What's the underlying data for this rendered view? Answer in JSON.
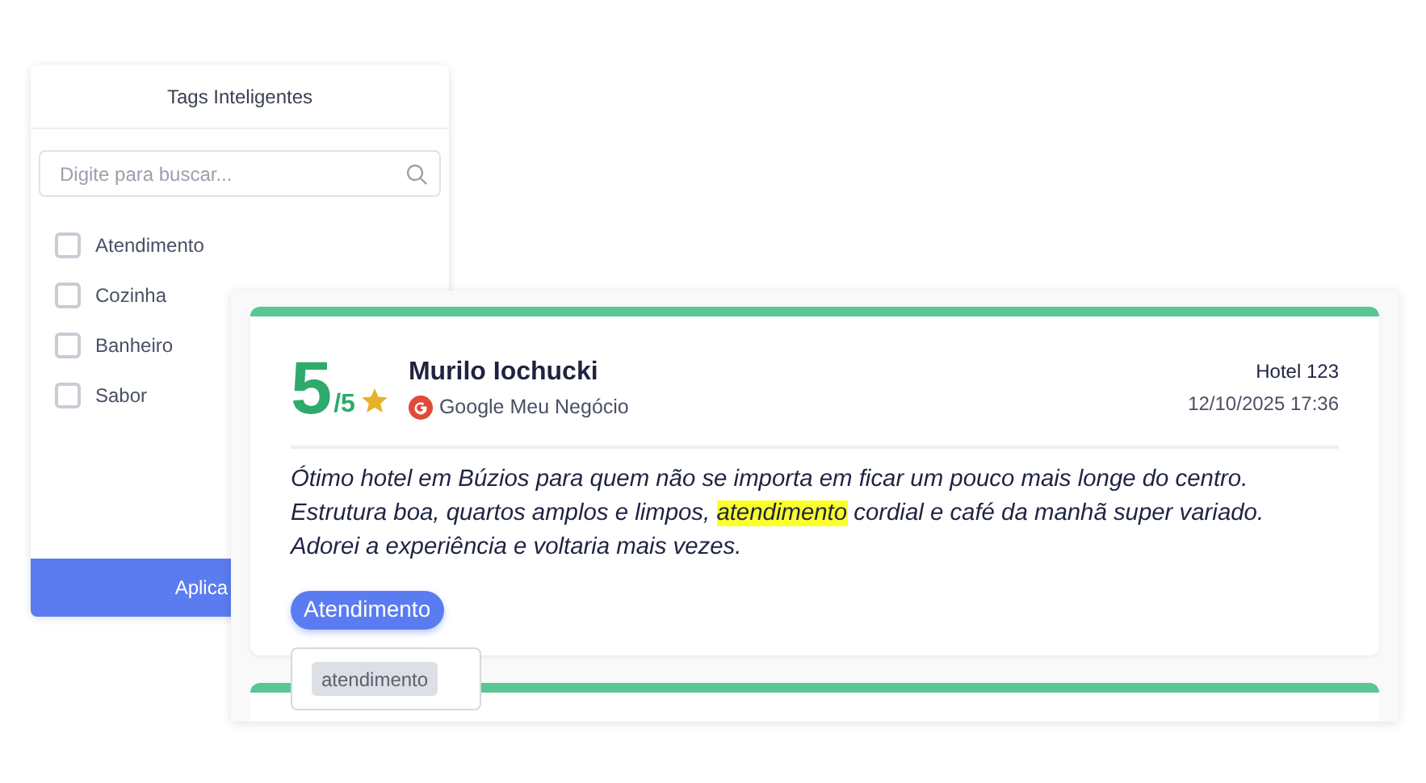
{
  "filter_panel": {
    "title": "Tags Inteligentes",
    "search": {
      "placeholder": "Digite para buscar..."
    },
    "tags": [
      {
        "label": "Atendimento",
        "checked": false
      },
      {
        "label": "Cozinha",
        "checked": false
      },
      {
        "label": "Banheiro",
        "checked": false
      },
      {
        "label": "Sabor",
        "checked": false
      }
    ],
    "apply_button": "Aplica"
  },
  "reviews": [
    {
      "score": "5",
      "out_of": "/5",
      "author": "Murilo Iochucki",
      "source": "Google Meu Negócio",
      "hotel": "Hotel 123",
      "date": "12/10/2025 17:36",
      "text": [
        {
          "text": "Ótimo hotel em Búzios para quem não se importa em ficar um pouco mais longe do centro. Estrutura boa, quartos amplos e limpos, ",
          "highlight": false
        },
        {
          "text": "atendimento",
          "highlight": true
        },
        {
          "text": " cordial e café da manhã super variado. Adorei a experiência e voltaria mais vezes.",
          "highlight": false
        }
      ],
      "tags": [
        "Atendimento"
      ],
      "tooltip": {
        "keyword": "atendimento"
      }
    }
  ]
}
